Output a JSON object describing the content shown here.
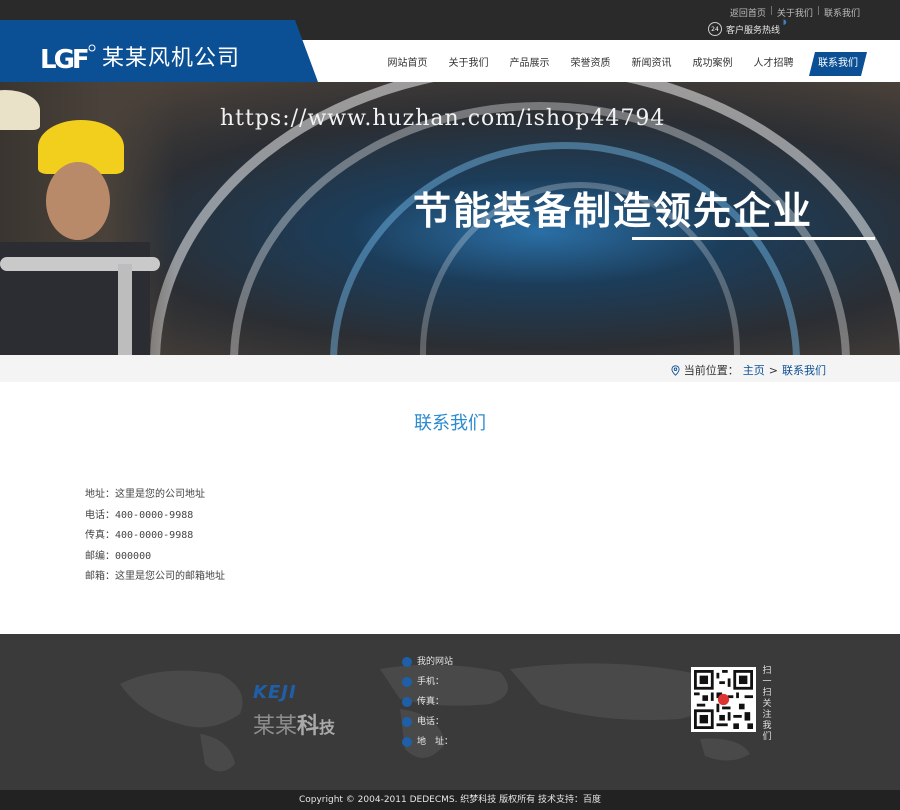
{
  "topbar": {
    "links": [
      "返回首页",
      "关于我们",
      "联系我们"
    ],
    "hotline_badge": "24",
    "hotline_label": "客户服务热线"
  },
  "header": {
    "logo_mark": "LGF",
    "company_name": "某某风机公司",
    "nav": [
      "网站首页",
      "关于我们",
      "产品展示",
      "荣誉资质",
      "新闻资讯",
      "成功案例",
      "人才招聘",
      "联系我们"
    ],
    "active_nav": "联系我们"
  },
  "banner": {
    "watermark": "https://www.huzhan.com/ishop44794",
    "slogan": "节能装备制造领先企业"
  },
  "breadcrumb": {
    "label": "当前位置：",
    "home": "主页",
    "sep": ">",
    "current": "联系我们"
  },
  "content": {
    "title": "联系我们",
    "contact": [
      {
        "label": "地址：",
        "value": "这里是您的公司地址"
      },
      {
        "label": "电话：",
        "value": "400-0000-9988"
      },
      {
        "label": "传真：",
        "value": "400-0000-9988"
      },
      {
        "label": "邮编：",
        "value": "000000"
      },
      {
        "label": "邮箱：",
        "value": "这里是您公司的邮箱地址"
      }
    ]
  },
  "footer": {
    "brand_en": "KEJI",
    "brand_cn_a": "某某",
    "brand_cn_b": "科",
    "brand_cn_c": "技",
    "info": [
      "我的网站",
      "手机：",
      "传真：",
      "电话：",
      "地　址："
    ],
    "scan_text": "扫一扫关注我们",
    "copyright": "Copyright © 2004-2011 DEDECMS. 织梦科技 版权所有 技术支持：百度"
  },
  "colors": {
    "brand_blue": "#0b4f95",
    "title_blue": "#2b8bd1",
    "footer_bg": "#3a3a3a"
  }
}
